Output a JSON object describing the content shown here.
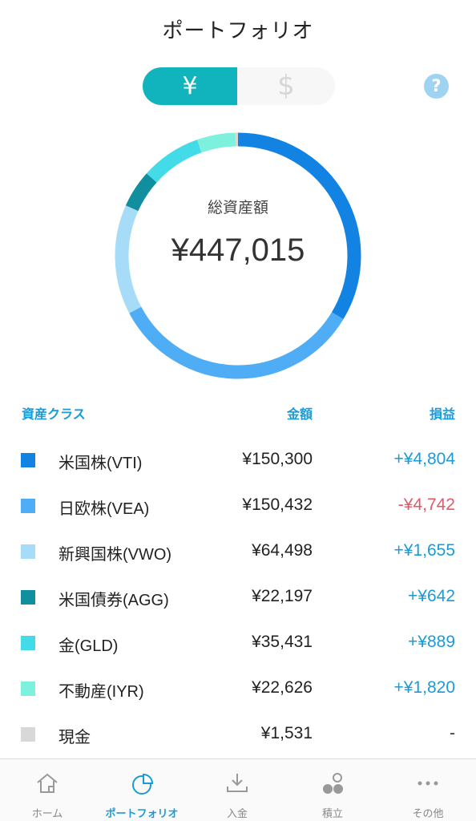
{
  "header": {
    "title": "ポートフォリオ"
  },
  "currency_toggle": {
    "yen_label": "¥",
    "dollar_label": "$",
    "selected": "¥"
  },
  "help": {
    "label": "?"
  },
  "summary": {
    "total_label": "総資産額",
    "total_value": "¥447,015"
  },
  "table": {
    "col_class": "資産クラス",
    "col_amount": "金額",
    "col_pl": "損益",
    "rows": [
      {
        "name": "米国株(VTI)",
        "amount": "¥150,300",
        "pl": "+¥4,804",
        "color": "#1283e3",
        "pl_color": "#1a9bd7",
        "value": 150300
      },
      {
        "name": "日欧株(VEA)",
        "amount": "¥150,432",
        "pl": "-¥4,742",
        "color": "#4fadf5",
        "pl_color": "#e05a6a",
        "value": 150432
      },
      {
        "name": "新興国株(VWO)",
        "amount": "¥64,498",
        "pl": "+¥1,655",
        "color": "#a6dcf8",
        "pl_color": "#1a9bd7",
        "value": 64498
      },
      {
        "name": "米国債券(AGG)",
        "amount": "¥22,197",
        "pl": "+¥642",
        "color": "#118f9e",
        "pl_color": "#1a9bd7",
        "value": 22197
      },
      {
        "name": "金(GLD)",
        "amount": "¥35,431",
        "pl": "+¥889",
        "color": "#43dbe8",
        "pl_color": "#1a9bd7",
        "value": 35431
      },
      {
        "name": "不動産(IYR)",
        "amount": "¥22,626",
        "pl": "+¥1,820",
        "color": "#7ef0de",
        "pl_color": "#1a9bd7",
        "value": 22626
      },
      {
        "name": "現金",
        "amount": "¥1,531",
        "pl": "-",
        "color": "#d8d8d8",
        "pl_color": "#333333",
        "value": 1531
      }
    ]
  },
  "tabbar": {
    "items": [
      {
        "label": "ホーム",
        "icon": "home-icon",
        "active": false
      },
      {
        "label": "ポートフォリオ",
        "icon": "portfolio-chart-icon",
        "active": true
      },
      {
        "label": "入金",
        "icon": "deposit-icon",
        "active": false
      },
      {
        "label": "積立",
        "icon": "savings-icon",
        "active": false
      },
      {
        "label": "その他",
        "icon": "more-icon",
        "active": false
      }
    ]
  },
  "colors": {
    "accent": "#11b3bd",
    "link": "#1a9bd7",
    "negative": "#e05a6a"
  }
}
